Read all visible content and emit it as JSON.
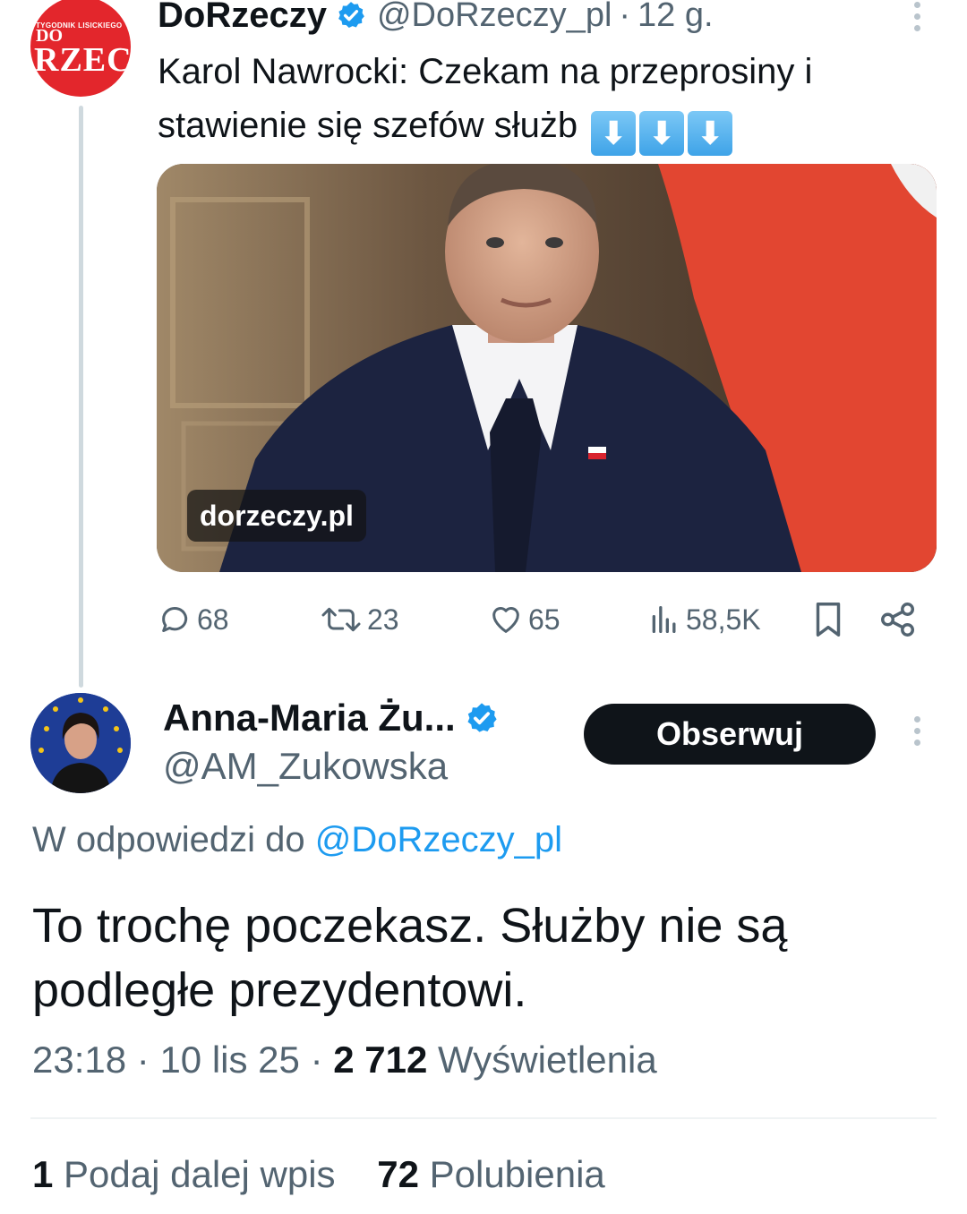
{
  "parent_tweet": {
    "author_name": "DoRzeczy",
    "handle": "@DoRzeczy_pl",
    "separator": "·",
    "time_ago": "12 g.",
    "avatar_small_text": "TYGODNIK LISICKIEGO",
    "avatar_line1": "DO",
    "avatar_line2": "RZEC",
    "text": "Karol Nawrocki: Czekam na przeprosiny i stawienie się szefów służb",
    "emoji_arrows": [
      "⬇",
      "⬇",
      "⬇"
    ],
    "media_badge": "dorzeczy.pl",
    "actions": {
      "replies": "68",
      "reposts": "23",
      "likes": "65",
      "views": "58,5K"
    }
  },
  "reply_tweet": {
    "author_name": "Anna-Maria Żu...",
    "handle": "@AM_Zukowska",
    "follow_label": "Obserwuj",
    "reply_to_prefix": "W odpowiedzi do",
    "reply_to_mention": "@DoRzeczy_pl",
    "text": "To trochę poczekasz. Służby nie są podległe prezydentowi.",
    "time": "23:18",
    "separator": "·",
    "date": "10 lis 25",
    "views_count": "2 712",
    "views_label": "Wyświetlenia",
    "reposts_count": "1",
    "reposts_label": "Podaj dalej wpis",
    "likes_count": "72",
    "likes_label": "Polubienia"
  },
  "colors": {
    "verified": "#1d9bf0",
    "mention": "#1d9bf0",
    "muted_text": "#536471",
    "follow_button": "#0f1419"
  }
}
